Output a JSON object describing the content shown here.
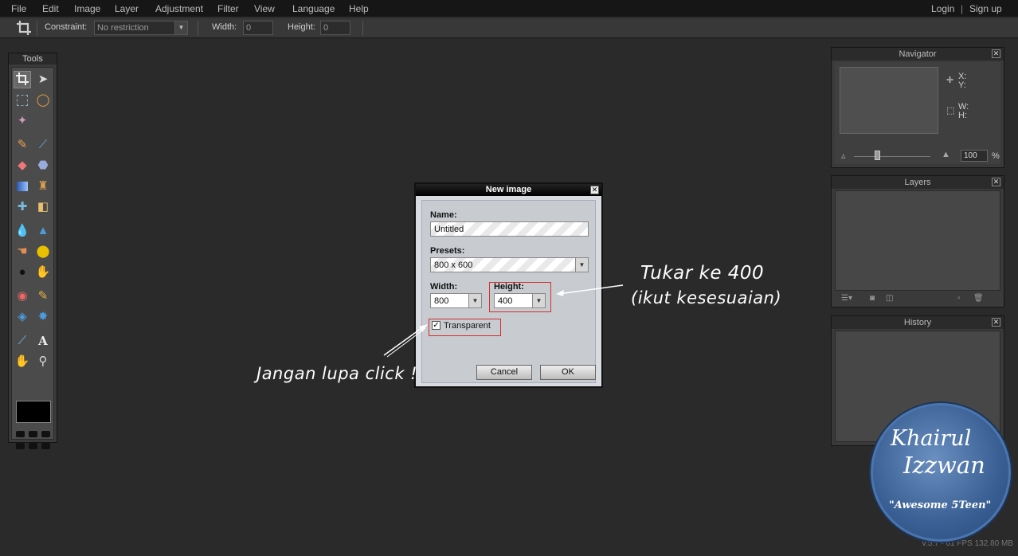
{
  "menubar": {
    "items": [
      "File",
      "Edit",
      "Image",
      "Layer",
      "Adjustment",
      "Filter",
      "View",
      "Language",
      "Help"
    ],
    "login": "Login",
    "separator": "|",
    "signup": "Sign up"
  },
  "optionsbar": {
    "constraint_label": "Constraint:",
    "constraint_value": "No restriction",
    "width_label": "Width:",
    "width_value": "0",
    "height_label": "Height:",
    "height_value": "0"
  },
  "tools": {
    "title": "Tools"
  },
  "navigator": {
    "title": "Navigator",
    "x_label": "X:",
    "y_label": "Y:",
    "w_label": "W:",
    "h_label": "H:",
    "zoom_value": "100",
    "zoom_unit": "%"
  },
  "layers": {
    "title": "Layers"
  },
  "history": {
    "title": "History"
  },
  "dialog": {
    "title": "New image",
    "name_label": "Name:",
    "name_value": "Untitled",
    "presets_label": "Presets:",
    "presets_value": "800 x 600",
    "width_label": "Width:",
    "width_value": "800",
    "height_label": "Height:",
    "height_value": "400",
    "transparent_label": "Transparent",
    "transparent_checked": true,
    "cancel_label": "Cancel",
    "ok_label": "OK"
  },
  "annotations": {
    "tukar_line1": "Tukar ke 400",
    "tukar_line2": "(ikut kesesuaian)",
    "jangan": "Jangan lupa click !"
  },
  "status": "v.5.7 - 61 FPS 132.80 MB",
  "watermark": {
    "line1": "Khairul",
    "line2": "Izzwan",
    "line3": "\"Awesome 5Teen\""
  }
}
